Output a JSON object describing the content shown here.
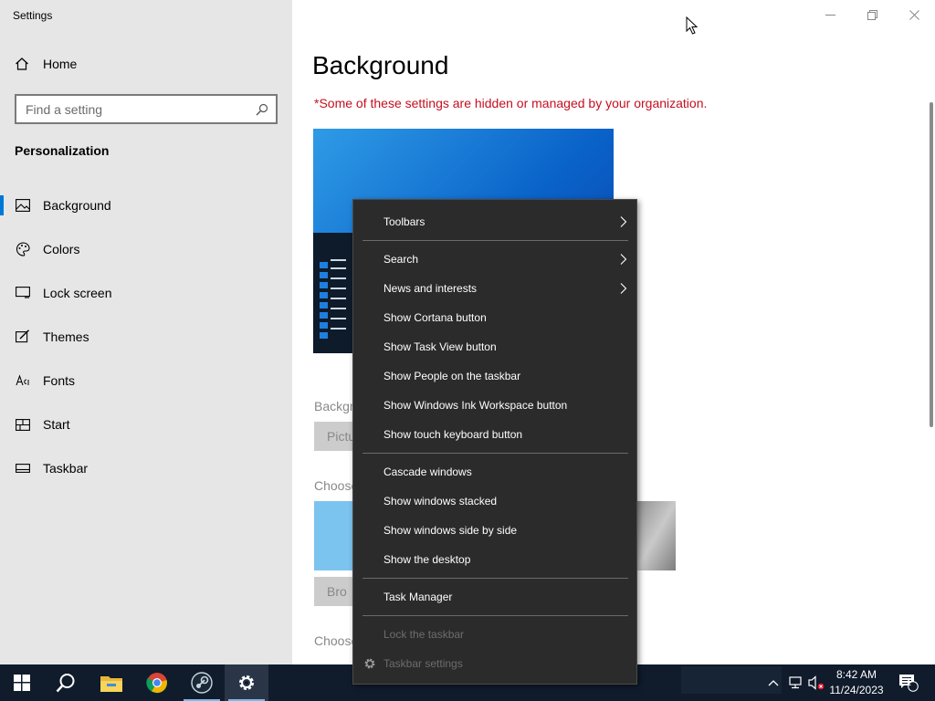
{
  "window": {
    "title": "Settings"
  },
  "sidebar": {
    "home_label": "Home",
    "search_placeholder": "Find a setting",
    "section_title": "Personalization",
    "items": [
      {
        "label": "Background",
        "icon": "picture-icon",
        "active": true
      },
      {
        "label": "Colors",
        "icon": "palette-icon"
      },
      {
        "label": "Lock screen",
        "icon": "lock-screen-icon"
      },
      {
        "label": "Themes",
        "icon": "brush-icon"
      },
      {
        "label": "Fonts",
        "icon": "font-icon"
      },
      {
        "label": "Start",
        "icon": "start-icon"
      },
      {
        "label": "Taskbar",
        "icon": "taskbar-icon"
      }
    ]
  },
  "main": {
    "title": "Background",
    "warning": "*Some of these settings are hidden or managed by your organization.",
    "background_label": "Backgr",
    "background_value": "Pictu",
    "choose_label_1": "Choose",
    "browse_label": "Bro",
    "choose_label_2": "Choose"
  },
  "context_menu": {
    "groups": [
      [
        {
          "label": "Toolbars",
          "submenu": true
        }
      ],
      [
        {
          "label": "Search",
          "submenu": true
        },
        {
          "label": "News and interests",
          "submenu": true
        },
        {
          "label": "Show Cortana button"
        },
        {
          "label": "Show Task View button"
        },
        {
          "label": "Show People on the taskbar"
        },
        {
          "label": "Show Windows Ink Workspace button"
        },
        {
          "label": "Show touch keyboard button"
        }
      ],
      [
        {
          "label": "Cascade windows"
        },
        {
          "label": "Show windows stacked"
        },
        {
          "label": "Show windows side by side"
        },
        {
          "label": "Show the desktop"
        }
      ],
      [
        {
          "label": "Task Manager"
        }
      ],
      [
        {
          "label": "Lock the taskbar",
          "disabled": true
        },
        {
          "label": "Taskbar settings",
          "disabled": true,
          "icon": "gear-icon"
        }
      ]
    ]
  },
  "taskbar": {
    "pinned": [
      "windows-start-icon",
      "search-icon",
      "file-explorer-icon",
      "chrome-icon",
      "steam-icon",
      "settings-icon"
    ],
    "clock_time": "8:42 AM",
    "clock_date": "11/24/2023",
    "notification_count": "1"
  },
  "colors": {
    "accent": "#0078d7",
    "warning": "#c50f1f",
    "menu_bg": "#2b2b2b",
    "taskbar_bg": "#101b2c"
  }
}
